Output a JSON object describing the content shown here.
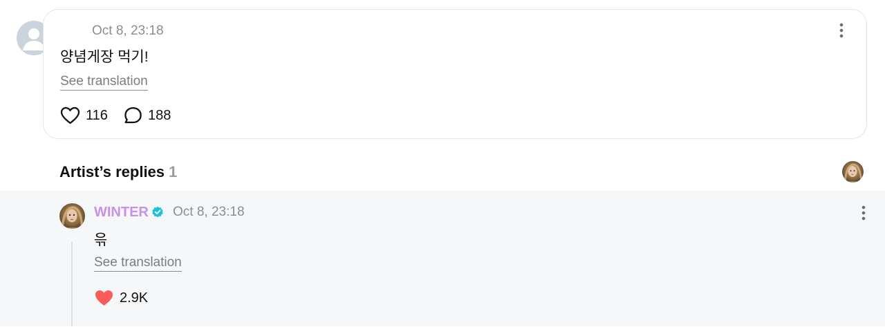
{
  "post": {
    "timestamp": "Oct 8, 23:18",
    "body": "양념게장 먹기!",
    "see_translation": "See translation",
    "likes": "116",
    "comments": "188"
  },
  "artist_replies": {
    "title": "Artist’s replies",
    "count": "1"
  },
  "reply": {
    "author": "WINTER",
    "timestamp": "Oct 8, 23:18",
    "body": "윾",
    "see_translation": "See translation",
    "likes": "2.9K",
    "liked": true
  },
  "colors": {
    "artist_name": "#c891e8",
    "verified": "#18c3d8",
    "heart_filled": "#f95a5a",
    "muted_text": "#8b8d91",
    "reply_background": "#f6f7f9"
  },
  "icons": {
    "post_more": "more-vertical-icon",
    "like": "heart-icon",
    "comment": "comment-icon",
    "verified": "verified-badge-icon",
    "reply_like": "heart-filled-icon"
  }
}
